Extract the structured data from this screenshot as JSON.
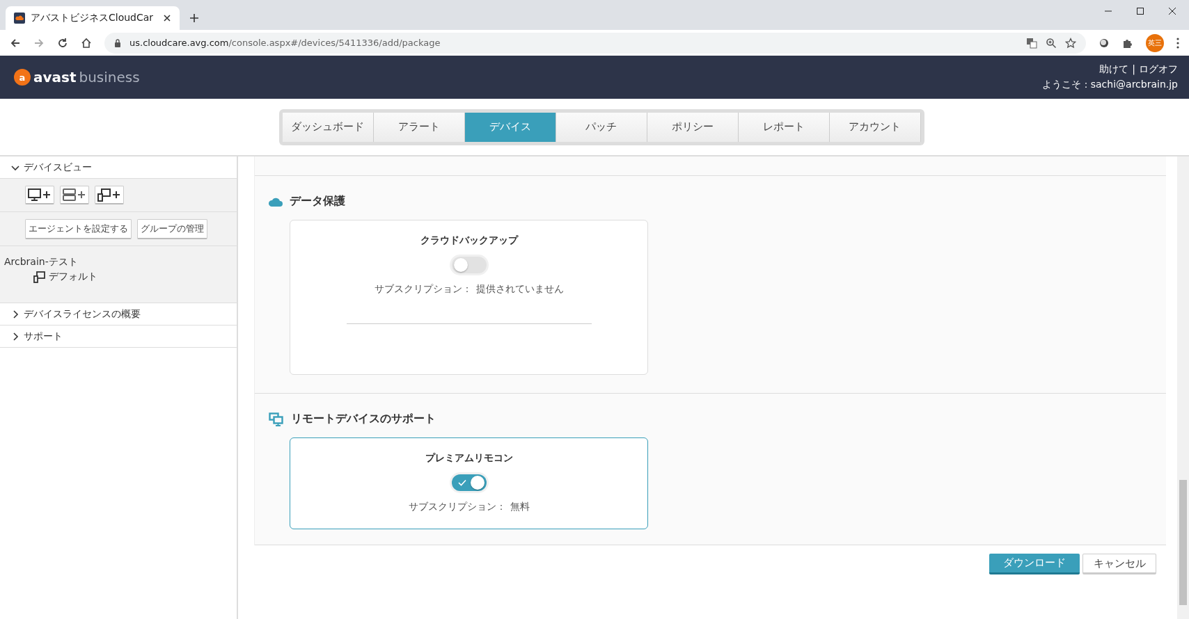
{
  "browser": {
    "tab_title": "アバストビジネスCloudCar",
    "url_host": "us.cloudcare.avg.com",
    "url_path": "/console.aspx#/devices/5411336/add/package",
    "profile": "英三"
  },
  "header": {
    "logo_mark": "a",
    "logo_brand": "avast",
    "logo_product": "business",
    "help": "助けて",
    "separator": "|",
    "logoff": "ログオフ",
    "welcome": "ようこそ：sachi@arcbrain.jp"
  },
  "nav_tabs": [
    {
      "label": "ダッシュボード",
      "selected": false
    },
    {
      "label": "アラート",
      "selected": false
    },
    {
      "label": "デバイス",
      "selected": true
    },
    {
      "label": "パッチ",
      "selected": false
    },
    {
      "label": "ポリシー",
      "selected": false
    },
    {
      "label": "レポート",
      "selected": false
    },
    {
      "label": "アカウント",
      "selected": false
    }
  ],
  "sidebar": {
    "device_view": {
      "label": "デバイスビュー",
      "expanded": true
    },
    "actions": [
      "エージェントを設定する",
      "グループの管理"
    ],
    "tree": {
      "label": "Arcbrain-テスト",
      "children": [
        {
          "label": "デフォルト"
        }
      ]
    },
    "sections": [
      {
        "label": "デバイスライセンスの概要",
        "expanded": false
      },
      {
        "label": "サポート",
        "expanded": false
      }
    ]
  },
  "sections": [
    {
      "kind": "cloud",
      "title": "データ保護",
      "card": {
        "name": "クラウドバックアップ",
        "on": false,
        "subscription_label": "サブスクリプション：",
        "subscription_value": "提供されていません",
        "divider": true
      }
    },
    {
      "kind": "remote",
      "title": "リモートデバイスのサポート",
      "card": {
        "name": "プレミアムリモコン",
        "on": true,
        "subscription_label": "サブスクリプション：",
        "subscription_value": "無料",
        "divider": false
      }
    }
  ],
  "buttons": [
    {
      "label": "ダウンロード",
      "kind": "primary"
    },
    {
      "label": "キャンセル",
      "kind": "secondary"
    }
  ]
}
